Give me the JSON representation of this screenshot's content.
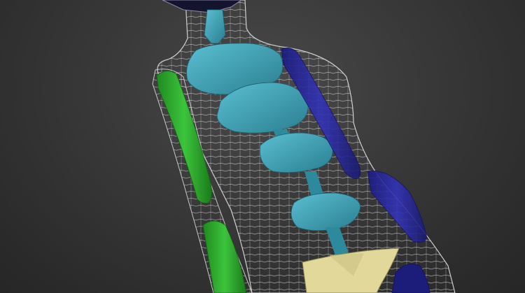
{
  "viewport": {
    "background_color": "#3a3a3a",
    "mesh_color": "#d8d8d8"
  },
  "bones": {
    "spine_color": "#3aa0b4",
    "left_arm_color": "#2faa2f",
    "right_arm_color": "#2c2ca8",
    "pelvis_color": "#e2d89a",
    "head_color": "#1a1a3a"
  }
}
